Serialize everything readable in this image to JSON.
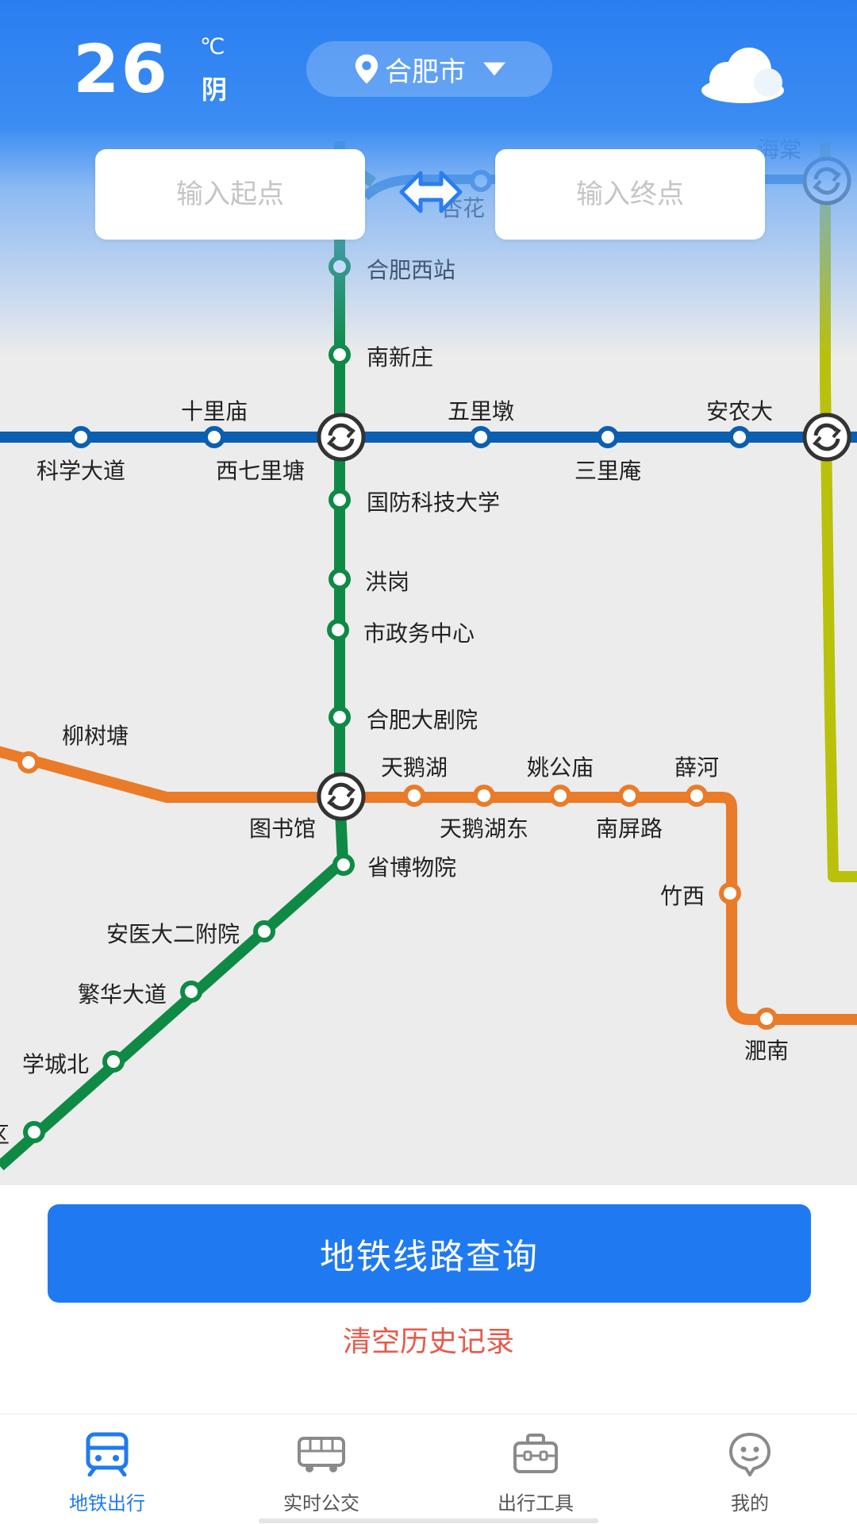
{
  "weather": {
    "temperature": "26",
    "unit": "℃",
    "condition": "阴",
    "icon": "cloud-icon"
  },
  "location": {
    "city": "合肥市"
  },
  "route_inputs": {
    "start_placeholder": "输入起点",
    "end_placeholder": "输入终点"
  },
  "lines": [
    {
      "name": "green-line",
      "color": "#0e8a45"
    },
    {
      "name": "blue-line",
      "color": "#0b5fb0"
    },
    {
      "name": "orange-line",
      "color": "#e97b29"
    },
    {
      "name": "yellow-line",
      "color": "#b9c10a"
    }
  ],
  "stations": [
    "杏花",
    "海棠",
    "合肥西站",
    "南新庄",
    "十里庙",
    "五里墩",
    "安农大",
    "科学大道",
    "西七里塘",
    "三里庵",
    "国防科技大学",
    "洪岗",
    "市政务中心",
    "合肥大剧院",
    "柳树塘",
    "天鹅湖",
    "姚公庙",
    "薛河",
    "图书馆",
    "天鹅湖东",
    "南屏路",
    "省博物院",
    "竹西",
    "安医大二附院",
    "繁华大道",
    "学城北",
    "淝南",
    "区"
  ],
  "actions": {
    "query_label": "地铁线路查询",
    "clear_label": "清空历史记录"
  },
  "tabs": [
    {
      "label": "地铁出行",
      "icon": "metro-icon",
      "active": true
    },
    {
      "label": "实时公交",
      "icon": "bus-icon",
      "active": false
    },
    {
      "label": "出行工具",
      "icon": "toolbox-icon",
      "active": false
    },
    {
      "label": "我的",
      "icon": "profile-icon",
      "active": false
    }
  ],
  "colors": {
    "accent": "#1f7af2",
    "clear": "#e65a4b"
  }
}
